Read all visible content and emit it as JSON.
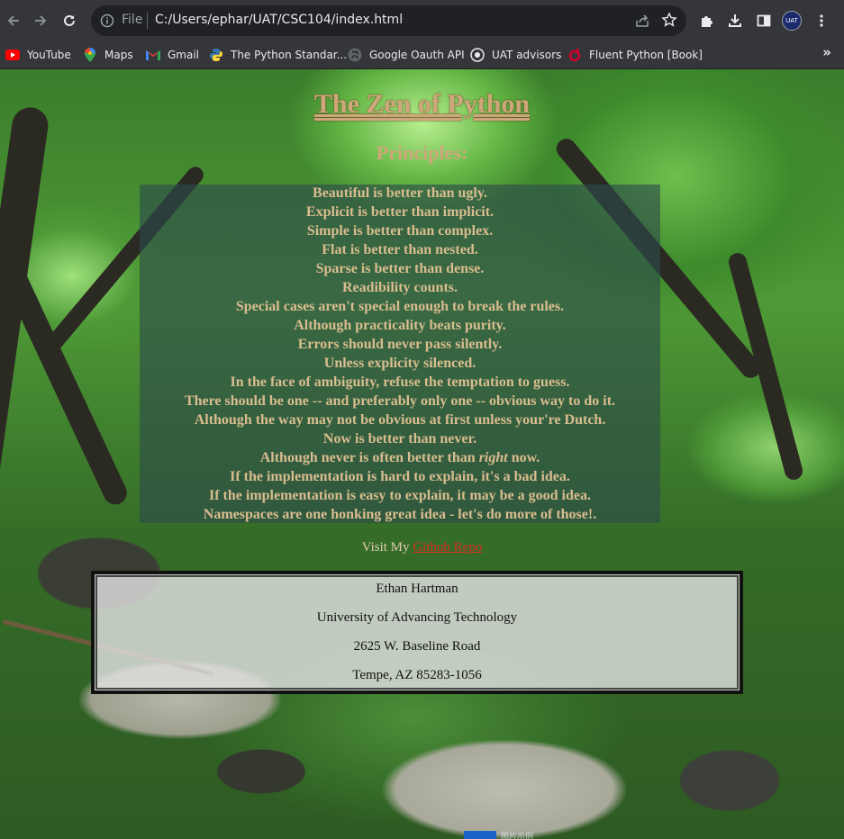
{
  "browser": {
    "scheme_label": "File",
    "url": "C:/Users/ephar/UAT/CSC104/index.html",
    "icons": [
      "back-icon",
      "forward-icon",
      "reload-icon",
      "info-icon",
      "share-icon",
      "star-icon",
      "extensions-icon",
      "download-icon",
      "sidepanel-icon",
      "avatar",
      "menu-icon"
    ],
    "avatar_text": "UAT",
    "bookmarks": [
      {
        "label": "YouTube",
        "icon": "youtube-icon",
        "color": "#ff0000"
      },
      {
        "label": "Maps",
        "icon": "maps-icon",
        "color": "#34a853"
      },
      {
        "label": "Gmail",
        "icon": "gmail-icon",
        "color": "#ea4335"
      },
      {
        "label": "The Python Standar...",
        "icon": "python-icon",
        "color": "#3776ab"
      },
      {
        "label": "Google Oauth API",
        "icon": "github-icon",
        "color": "#e8eaed"
      },
      {
        "label": "UAT advisors",
        "icon": "uat-icon",
        "color": "#e8eaed"
      },
      {
        "label": "Fluent Python [Book]",
        "icon": "oreilly-icon",
        "color": "#d3002d"
      }
    ],
    "more_label": "»"
  },
  "page": {
    "title": "The Zen of Python",
    "subtitle": "Principles:",
    "zen": [
      "Beautiful is better than ugly.",
      "Explicit is better than implicit.",
      "Simple is better than complex.",
      "Flat is better than nested.",
      "Sparse is better than dense.",
      "Readibility counts.",
      "Special cases aren't special enough to break the rules.",
      "Although practicality beats purity.",
      "Errors should never pass silently.",
      "Unless explicity silenced.",
      "In the face of ambiguity, refuse the temptation to guess.",
      "There should be one -- and preferably only one -- obvious way to do it.",
      "Although the way may not be obvious at first unless your're Dutch.",
      "Now is better than never.",
      "Although never is often better than",
      "right",
      " now.",
      "If the implementation is hard to explain, it's a bad idea.",
      "If the implementation is easy to explain, it may be a good idea.",
      "Namespaces are one honking great idea - let's do more of those!."
    ],
    "visit_prefix": "Visit My ",
    "repo_link": "Github Repo",
    "address": [
      "Ethan Hartman",
      "University of Advancing Technology",
      "2625 W. Baseline Road",
      "Tempe, AZ 85283-1056"
    ]
  },
  "taskbar": {
    "text": "图片示例"
  }
}
